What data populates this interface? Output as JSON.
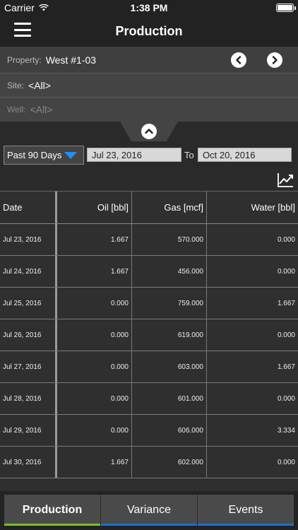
{
  "status": {
    "carrier": "Carrier",
    "time": "1:38 PM"
  },
  "nav": {
    "title": "Production"
  },
  "filters": {
    "property_label": "Property:",
    "property_value": "West #1-03",
    "site_label": "Site:",
    "site_value": "<All>",
    "well_label": "Well:",
    "well_value": "<All>"
  },
  "range": {
    "preset": "Past 90 Days",
    "start": "Jul 23, 2016",
    "to_label": "To",
    "end": "Oct 20, 2016"
  },
  "table": {
    "headers": [
      "Date",
      "Oil [bbl]",
      "Gas [mcf]",
      "Water [bbl]"
    ],
    "rows": [
      [
        "Jul 23, 2016",
        "1.667",
        "570.000",
        "0.000"
      ],
      [
        "Jul 24, 2016",
        "1.667",
        "456.000",
        "0.000"
      ],
      [
        "Jul 25, 2016",
        "0.000",
        "759.000",
        "1.667"
      ],
      [
        "Jul 26, 2016",
        "0.000",
        "619.000",
        "0.000"
      ],
      [
        "Jul 27, 2016",
        "0.000",
        "603.000",
        "1.667"
      ],
      [
        "Jul 28, 2016",
        "0.000",
        "601.000",
        "0.000"
      ],
      [
        "Jul 29, 2016",
        "0.000",
        "606.000",
        "3.334"
      ],
      [
        "Jul 30, 2016",
        "1.667",
        "602.000",
        "0.000"
      ]
    ]
  },
  "tabs": [
    {
      "label": "Production",
      "active": true
    },
    {
      "label": "Variance",
      "active": false
    },
    {
      "label": "Events",
      "active": false
    }
  ],
  "colors": {
    "active_tab_accent": "#7bbf2a",
    "tab_accent": "#1e6fd0",
    "dropdown_arrow": "#1e90ff"
  },
  "icons": [
    "menu-icon",
    "chevron-left-icon",
    "chevron-right-icon",
    "chevron-up-icon",
    "dropdown-triangle-icon",
    "chart-icon",
    "wifi-icon",
    "battery-icon"
  ]
}
